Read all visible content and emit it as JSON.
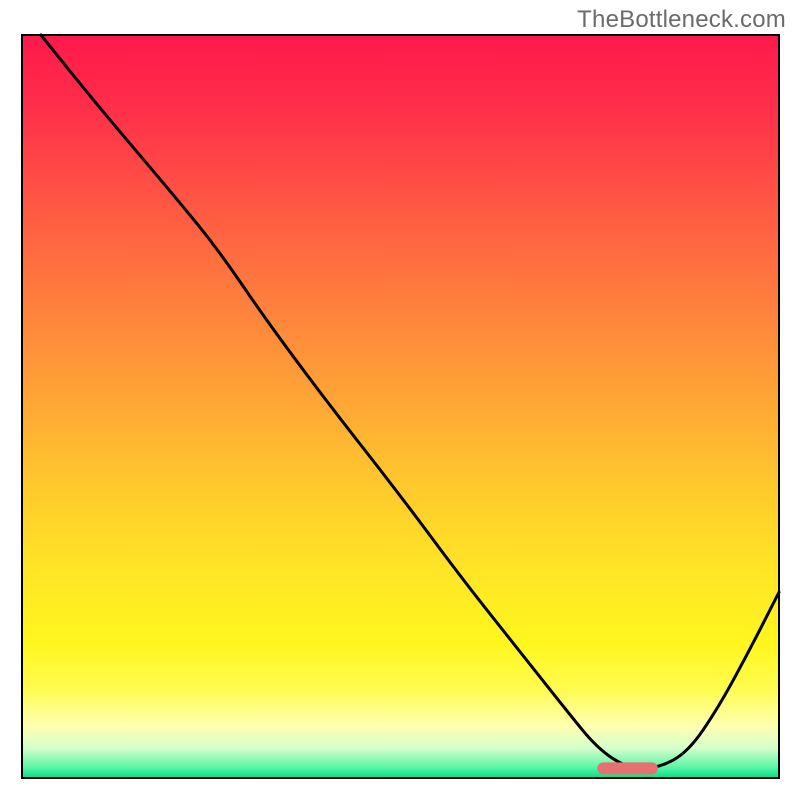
{
  "watermark": "TheBottleneck.com",
  "chart_data": {
    "type": "line",
    "title": "",
    "xlabel": "",
    "ylabel": "",
    "xlim": [
      0,
      100
    ],
    "ylim": [
      0,
      100
    ],
    "gradient_stops": [
      {
        "offset": 0.0,
        "color": "#ff194b"
      },
      {
        "offset": 0.1,
        "color": "#ff2f4a"
      },
      {
        "offset": 0.22,
        "color": "#ff5544"
      },
      {
        "offset": 0.35,
        "color": "#ff7c3e"
      },
      {
        "offset": 0.48,
        "color": "#ffa236"
      },
      {
        "offset": 0.6,
        "color": "#ffc72d"
      },
      {
        "offset": 0.72,
        "color": "#ffe526"
      },
      {
        "offset": 0.82,
        "color": "#fff61f"
      },
      {
        "offset": 0.88,
        "color": "#fffc4f"
      },
      {
        "offset": 0.93,
        "color": "#ffffb0"
      },
      {
        "offset": 0.96,
        "color": "#d4ffcb"
      },
      {
        "offset": 0.985,
        "color": "#5ff5a6"
      },
      {
        "offset": 1.0,
        "color": "#00e08a"
      }
    ],
    "series": [
      {
        "name": "bottleneck-curve",
        "x": [
          2.5,
          10.0,
          20.0,
          26.0,
          32.0,
          40.0,
          50.0,
          58.0,
          65.0,
          72.0,
          76.0,
          80.0,
          84.0,
          88.0,
          92.0,
          96.0,
          100.0
        ],
        "values": [
          100.0,
          90.5,
          78.5,
          71.0,
          62.0,
          51.0,
          38.0,
          27.0,
          18.0,
          9.0,
          4.0,
          1.3,
          1.3,
          3.5,
          9.5,
          17.0,
          25.0
        ]
      }
    ],
    "marker": {
      "name": "current-range-marker",
      "x_start": 76.0,
      "x_end": 84.0,
      "y": 1.3,
      "color": "#e77170"
    }
  }
}
